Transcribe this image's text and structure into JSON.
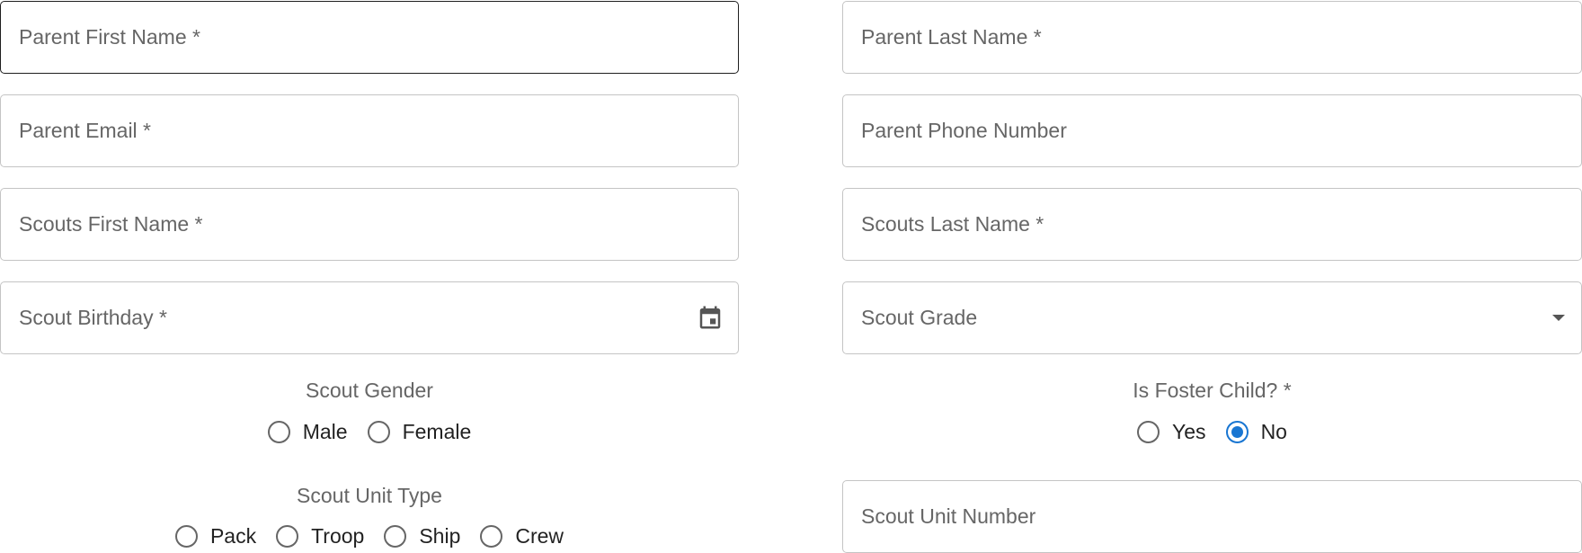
{
  "form": {
    "parent_first_name": {
      "placeholder": "Parent First Name *",
      "value": ""
    },
    "parent_last_name": {
      "placeholder": "Parent Last Name *",
      "value": ""
    },
    "parent_email": {
      "placeholder": "Parent Email *",
      "value": ""
    },
    "parent_phone": {
      "placeholder": "Parent Phone Number",
      "value": ""
    },
    "scouts_first_name": {
      "placeholder": "Scouts First Name *",
      "value": ""
    },
    "scouts_last_name": {
      "placeholder": "Scouts Last Name *",
      "value": ""
    },
    "scout_birthday": {
      "placeholder": "Scout Birthday *",
      "value": "",
      "icon": "calendar-icon"
    },
    "scout_grade": {
      "placeholder": "Scout Grade",
      "value": "",
      "icon": "dropdown-arrow-icon"
    },
    "scout_gender": {
      "label": "Scout Gender",
      "options": [
        {
          "label": "Male",
          "checked": false
        },
        {
          "label": "Female",
          "checked": false
        }
      ]
    },
    "is_foster_child": {
      "label": "Is Foster Child? *",
      "options": [
        {
          "label": "Yes",
          "checked": false
        },
        {
          "label": "No",
          "checked": true
        }
      ]
    },
    "scout_unit_type": {
      "label": "Scout Unit Type",
      "options": [
        {
          "label": "Pack",
          "checked": false
        },
        {
          "label": "Troop",
          "checked": false
        },
        {
          "label": "Ship",
          "checked": false
        },
        {
          "label": "Crew",
          "checked": false
        }
      ]
    },
    "scout_unit_number": {
      "placeholder": "Scout Unit Number",
      "value": ""
    }
  },
  "colors": {
    "accent": "#1976d2",
    "border": "#c4c4c4",
    "focused_border": "#1f1f1f",
    "placeholder": "#666666"
  }
}
